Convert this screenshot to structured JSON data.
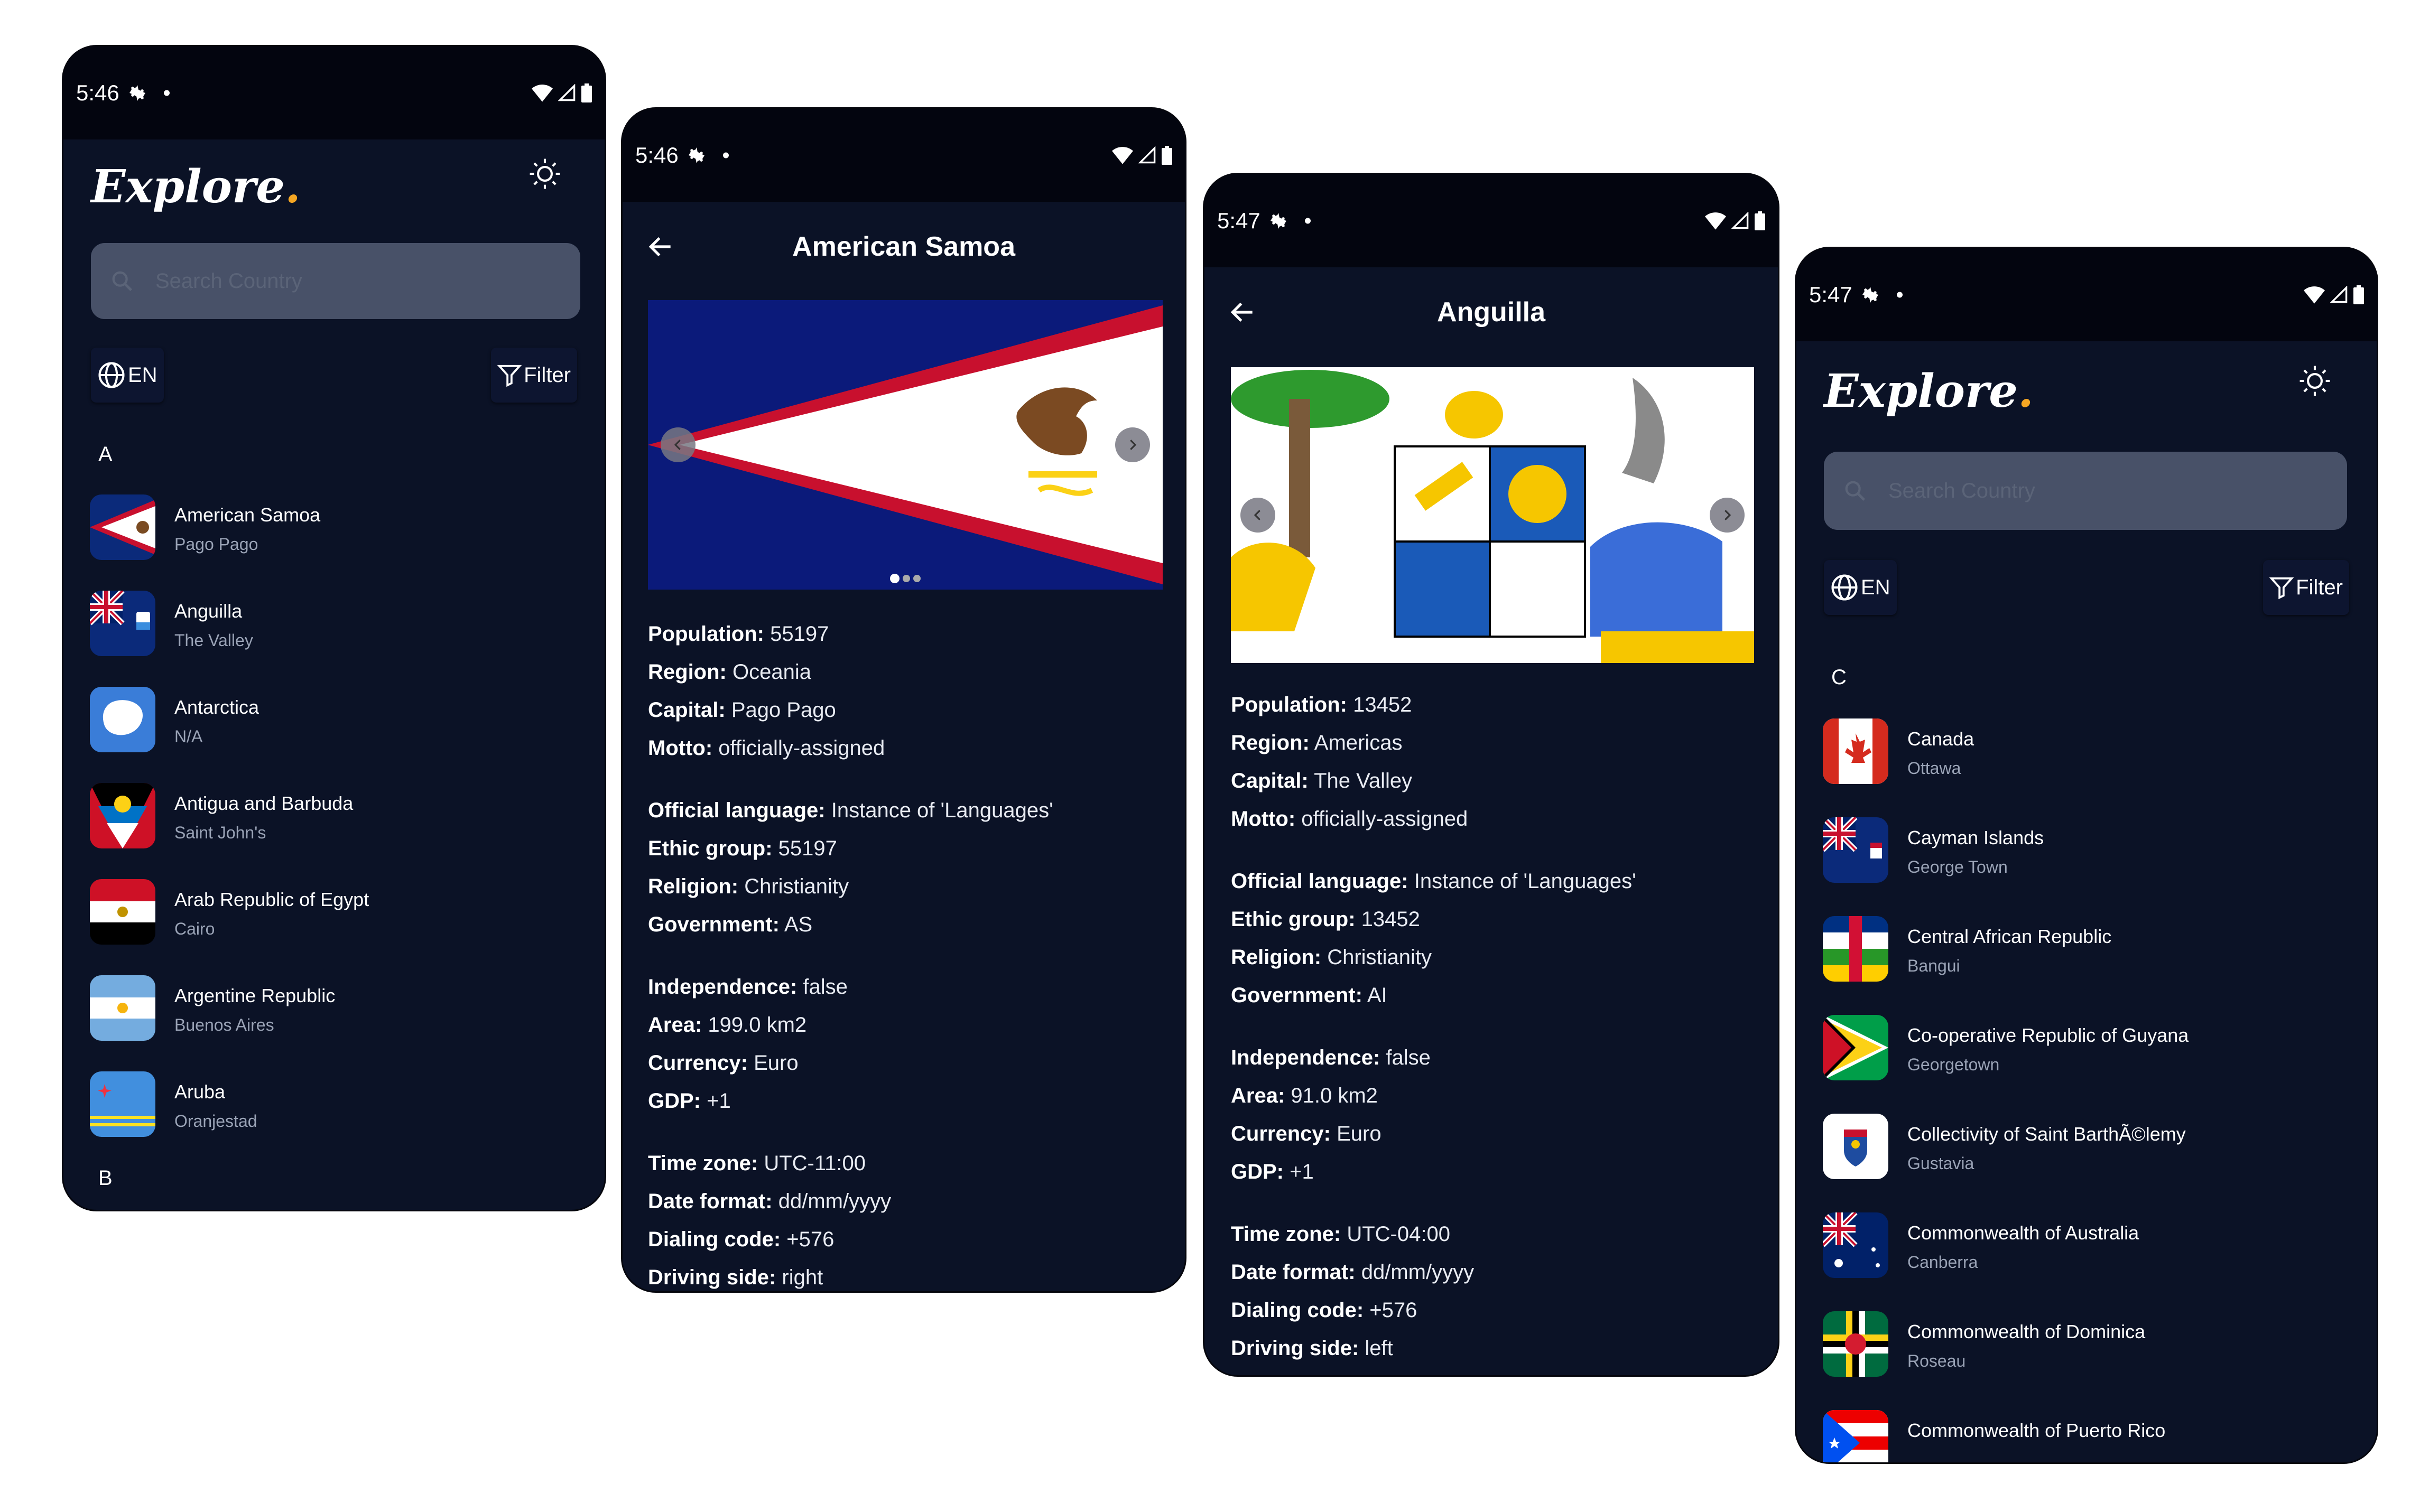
{
  "status": {
    "phone1": {
      "time": "5:46"
    },
    "phone2": {
      "time": "5:46"
    },
    "phone3": {
      "time": "5:47"
    },
    "phone4": {
      "time": "5:47"
    }
  },
  "app": {
    "logo": "Explore",
    "logo_dot": ".",
    "search_placeholder": "Search Country",
    "lang": "EN",
    "filter": "Filter"
  },
  "list1": {
    "section_a": "A",
    "section_b": "B",
    "items": [
      {
        "name": "American Samoa",
        "capital": "Pago Pago"
      },
      {
        "name": "Anguilla",
        "capital": "The Valley"
      },
      {
        "name": "Antarctica",
        "capital": "N/A"
      },
      {
        "name": "Antigua and Barbuda",
        "capital": "Saint John's"
      },
      {
        "name": "Arab Republic of Egypt",
        "capital": "Cairo"
      },
      {
        "name": "Argentine Republic",
        "capital": "Buenos Aires"
      },
      {
        "name": "Aruba",
        "capital": "Oranjestad"
      }
    ]
  },
  "detail1": {
    "title": "American Samoa",
    "labels": [
      "Population:",
      "Region:",
      "Capital:",
      "Motto:",
      "Official language:",
      "Ethic group:",
      "Religion:",
      "Government:",
      "Independence:",
      "Area:",
      "Currency:",
      "GDP:",
      "Time zone:",
      "Date format:",
      "Dialing code:",
      "Driving side:"
    ],
    "values": [
      "55197",
      "Oceania",
      "Pago Pago",
      "officially-assigned",
      "Instance of 'Languages'",
      "55197",
      "Christianity",
      "AS",
      "false",
      "199.0 km2",
      "Euro",
      "+1",
      "UTC-11:00",
      "dd/mm/yyyy",
      "+576",
      "right"
    ]
  },
  "detail2": {
    "title": "Anguilla",
    "labels": [
      "Population:",
      "Region:",
      "Capital:",
      "Motto:",
      "Official language:",
      "Ethic group:",
      "Religion:",
      "Government:",
      "Independence:",
      "Area:",
      "Currency:",
      "GDP:",
      "Time zone:",
      "Date format:",
      "Dialing code:",
      "Driving side:"
    ],
    "values": [
      "13452",
      "Americas",
      "The Valley",
      "officially-assigned",
      "Instance of 'Languages'",
      "13452",
      "Christianity",
      "AI",
      "false",
      "91.0 km2",
      "Euro",
      "+1",
      "UTC-04:00",
      "dd/mm/yyyy",
      "+576",
      "left"
    ]
  },
  "list2": {
    "section_c": "C",
    "items": [
      {
        "name": "Canada",
        "capital": "Ottawa"
      },
      {
        "name": "Cayman Islands",
        "capital": "George Town"
      },
      {
        "name": "Central African Republic",
        "capital": "Bangui"
      },
      {
        "name": "Co-operative Republic of Guyana",
        "capital": "Georgetown"
      },
      {
        "name": "Collectivity of Saint BarthÃ©lemy",
        "capital": "Gustavia"
      },
      {
        "name": "Commonwealth of Australia",
        "capital": "Canberra"
      },
      {
        "name": "Commonwealth of Dominica",
        "capital": "Roseau"
      },
      {
        "name": "Commonwealth of Puerto Rico",
        "capital": ""
      }
    ]
  },
  "colors": {
    "background": "#0b1226",
    "statusbar": "#03050f",
    "search": "#485168",
    "accent": "#f5a623"
  }
}
